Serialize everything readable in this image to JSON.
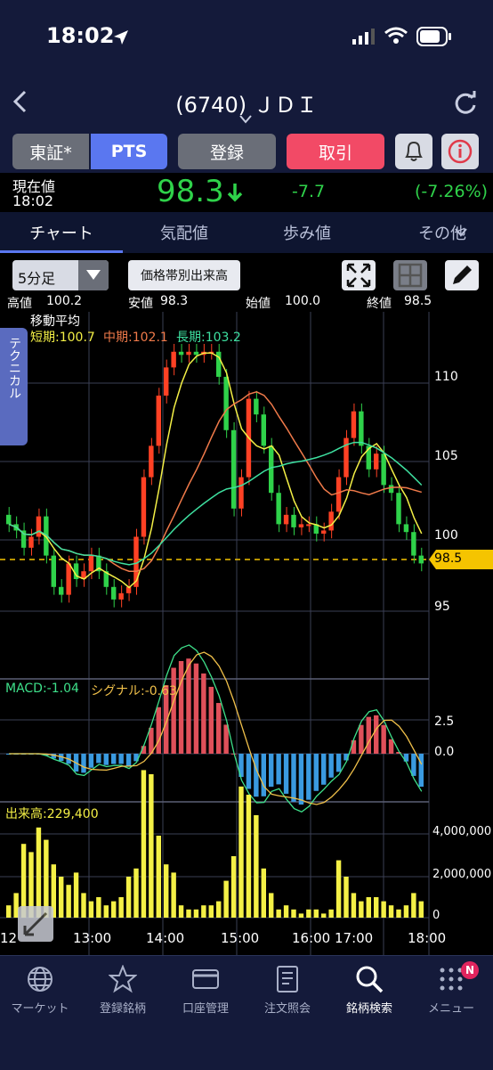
{
  "status": {
    "time": "18:02"
  },
  "nav": {
    "title": "(6740) ＪＤＩ"
  },
  "buttons": {
    "tosho": "東証*",
    "pts": "PTS",
    "register": "登録",
    "trade": "取引"
  },
  "price": {
    "label": "現在値",
    "time": "18:02",
    "value": "98.3",
    "change": "-7.7",
    "change_pct": "(-7.26%)",
    "arrow": "down-arrow-icon"
  },
  "tabs": [
    {
      "label": "チャート"
    },
    {
      "label": "気配値"
    },
    {
      "label": "歩み値"
    },
    {
      "label": "その他"
    }
  ],
  "toolbar": {
    "interval": "5分足",
    "volume_by_price": "価格帯別出来高"
  },
  "ohlc": {
    "high_label": "高値",
    "high": "100.2",
    "low_label": "安値",
    "low": "98.3",
    "open_label": "始値",
    "open": "100.0",
    "close_label": "終値",
    "close": "98.5"
  },
  "ma": {
    "title": "移動平均",
    "short": "短期:100.7",
    "mid": "中期:102.1",
    "long": "長期:103.2"
  },
  "side_tab": "テクニカル",
  "price_axis": {
    "labels": [
      "110",
      "105",
      "100",
      "95"
    ],
    "current": "98.5"
  },
  "macd": {
    "macd": "MACD:-1.04",
    "signal": "シグナル:-0.63",
    "axis": [
      "2.5",
      "0.0"
    ]
  },
  "volume": {
    "label": "出来高:229,400",
    "axis": [
      "4,000,000",
      "2,000,000",
      "0"
    ]
  },
  "x_axis": {
    "labels": [
      "12",
      "13:00",
      "14:00",
      "15:00",
      "16:00",
      "17:00",
      "18:00"
    ]
  },
  "bottom_nav": [
    {
      "label": "マーケット",
      "icon": "globe-icon"
    },
    {
      "label": "登録銘柄",
      "icon": "star-icon"
    },
    {
      "label": "口座管理",
      "icon": "card-icon"
    },
    {
      "label": "注文照会",
      "icon": "document-icon"
    },
    {
      "label": "銘柄検索",
      "icon": "search-icon"
    },
    {
      "label": "メニュー",
      "icon": "menu-grid-icon",
      "badge": "N"
    }
  ],
  "colors": {
    "up": "#ff4124",
    "down": "#2fd24a",
    "accent": "#5a77f0",
    "trade": "#f24a66",
    "short_ma": "#f4f046",
    "mid_ma": "#f07a4a",
    "long_ma": "#3ee0a0",
    "volume": "#f4f046"
  }
}
